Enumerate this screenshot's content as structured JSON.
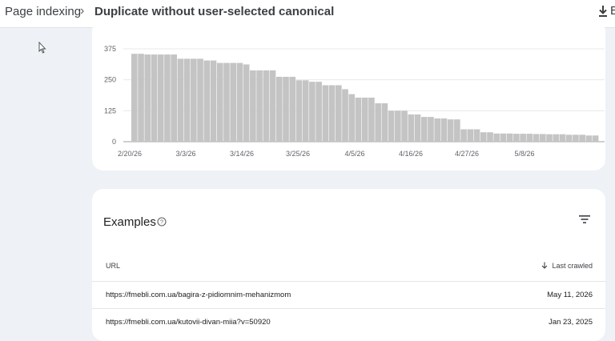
{
  "breadcrumb": {
    "root": "Page indexing",
    "separator": "›",
    "current": "Duplicate without user-selected canonical"
  },
  "toolbar": {
    "download_icon": "download-icon",
    "edge_text": "E"
  },
  "chart_data": {
    "type": "bar",
    "title": "",
    "xlabel": "",
    "ylabel": "",
    "ylim": [
      0,
      375
    ],
    "yticks": [
      0,
      125,
      250,
      375
    ],
    "xtick_labels": [
      "2/20/26",
      "3/3/26",
      "3/14/26",
      "3/25/26",
      "4/5/26",
      "4/16/26",
      "4/27/26",
      "5/8/26"
    ],
    "bar_color": "#c4c4c4",
    "grid": true,
    "values": [
      355,
      355,
      352,
      352,
      352,
      352,
      352,
      335,
      335,
      335,
      335,
      328,
      328,
      318,
      318,
      318,
      318,
      312,
      288,
      288,
      288,
      288,
      262,
      262,
      262,
      248,
      248,
      242,
      242,
      228,
      228,
      228,
      212,
      192,
      178,
      178,
      178,
      155,
      155,
      125,
      125,
      125,
      110,
      110,
      100,
      100,
      94,
      94,
      90,
      90,
      50,
      50,
      50,
      38,
      38,
      33,
      33,
      33,
      32,
      32,
      32,
      31,
      31,
      30,
      30,
      30,
      28,
      28,
      28,
      25,
      25
    ]
  },
  "examples": {
    "title": "Examples",
    "help_icon": "help-icon",
    "filter_icon": "filter-icon",
    "columns": {
      "url": "URL",
      "last_crawled": "Last crawled"
    },
    "rows": [
      {
        "url": "https://fmebli.com.ua/bagira-z-pidiomnim-mehanizmom",
        "date": "May 11, 2026"
      },
      {
        "url": "https://fmebli.com.ua/kutovii-divan-miia?v=50920",
        "date": "Jan 23, 2025"
      }
    ]
  }
}
